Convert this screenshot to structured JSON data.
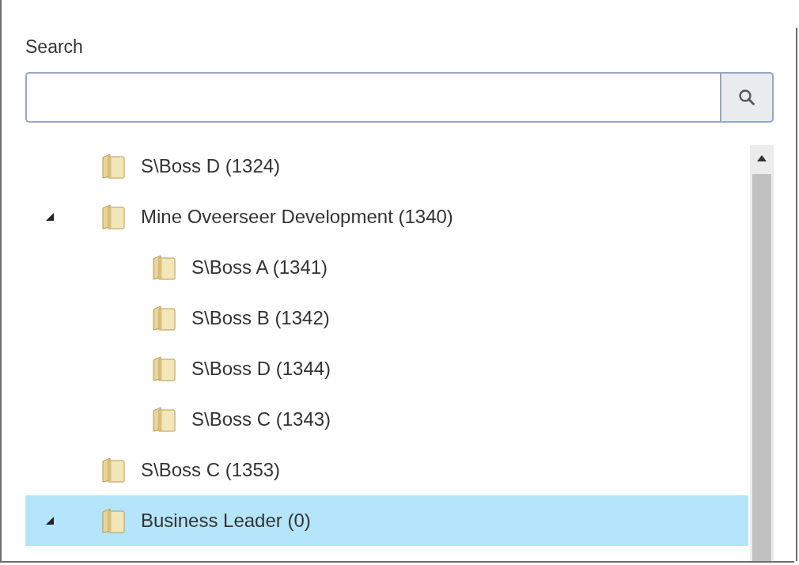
{
  "search": {
    "label": "Search"
  },
  "tree": [
    {
      "label": "S\\Boss D (1324)",
      "selected": false
    },
    {
      "label": "Mine Oveerseer Development (1340)",
      "selected": false,
      "expanded": true,
      "children": [
        {
          "label": "S\\Boss A (1341)",
          "selected": false
        },
        {
          "label": "S\\Boss B (1342)",
          "selected": false
        },
        {
          "label": "S\\Boss D (1344)",
          "selected": false
        },
        {
          "label": "S\\Boss C (1343)",
          "selected": false
        }
      ]
    },
    {
      "label": "S\\Boss C (1353)",
      "selected": false
    },
    {
      "label": "Business Leader (0)",
      "selected": true,
      "expanded": true
    }
  ]
}
